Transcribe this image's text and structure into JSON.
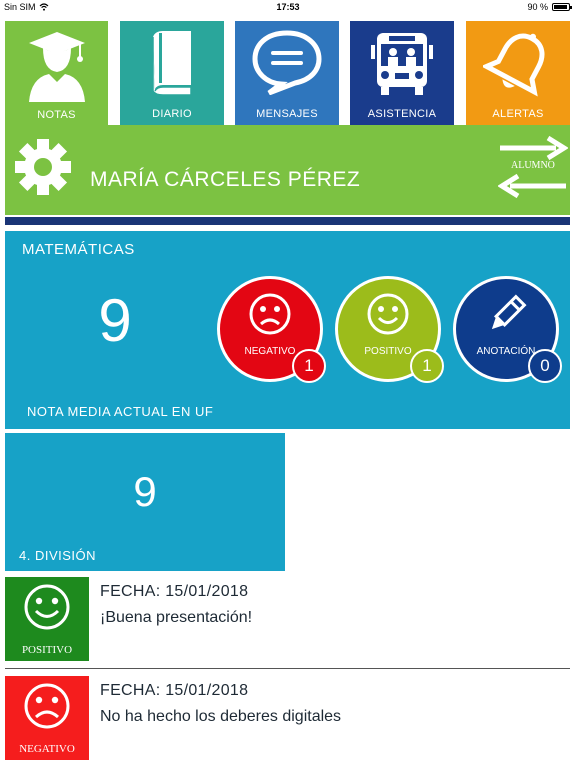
{
  "status_bar": {
    "carrier": "Sin SIM",
    "time": "17:53",
    "battery": "90 %",
    "battery_level": 0.9
  },
  "nav": {
    "tabs": [
      {
        "label": "NOTAS",
        "color": "#7cc242",
        "icon": "graduate-icon",
        "active": true
      },
      {
        "label": "DIARIO",
        "color": "#2aa69b",
        "icon": "book-icon"
      },
      {
        "label": "MENSAJES",
        "color": "#2f76bd",
        "icon": "chat-bubble-icon"
      },
      {
        "label": "ASISTENCIA",
        "color": "#1a3c8c",
        "icon": "school-bus-icon"
      },
      {
        "label": "ALERTAS",
        "color": "#f29a13",
        "icon": "bell-icon"
      }
    ]
  },
  "student": {
    "name": "MARÍA CÁRCELES PÉREZ",
    "switch_label": "ALUMNO"
  },
  "subject": {
    "name": "MATEMÁTICAS",
    "average_grade": "9",
    "average_label": "NOTA MEDIA ACTUAL EN UF",
    "summary": [
      {
        "label": "NEGATIVO",
        "count": "1",
        "color": "#e30613",
        "icon": "sad-face-icon"
      },
      {
        "label": "POSITIVO",
        "count": "1",
        "color": "#9cbc1b",
        "icon": "happy-face-icon"
      },
      {
        "label": "ANOTACIÓN",
        "count": "0",
        "color": "#0e3c8c",
        "icon": "pencil-icon"
      }
    ]
  },
  "division": {
    "grade": "9",
    "label": "4. DIVISIÓN"
  },
  "annotations": [
    {
      "type": "POSITIVO",
      "date": "FECHA: 15/01/2018",
      "text": "¡Buena presentación!",
      "color": "#1e8a1e",
      "icon": "happy-face-icon"
    },
    {
      "type": "NEGATIVO",
      "date": "FECHA: 15/01/2018",
      "text": "No ha hecho los deberes digitales",
      "color": "#f51d1d",
      "icon": "sad-face-icon"
    }
  ]
}
